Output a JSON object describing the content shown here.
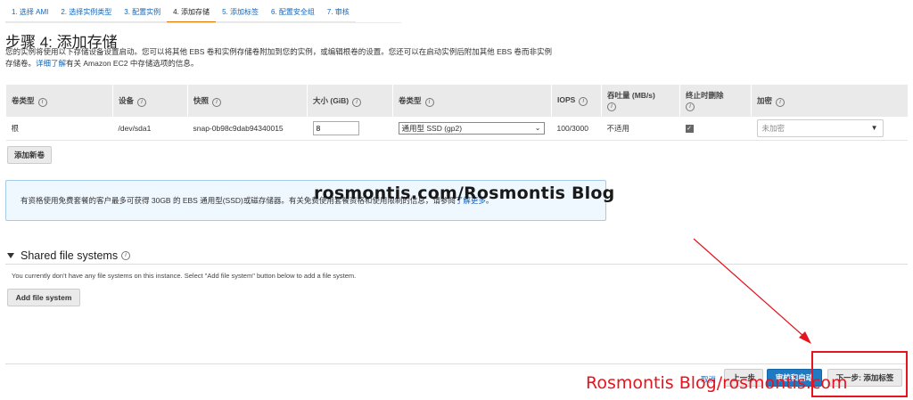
{
  "steps": [
    {
      "label": "1. 选择 AMI"
    },
    {
      "label": "2. 选择实例类型"
    },
    {
      "label": "3. 配置实例"
    },
    {
      "label": "4. 添加存储"
    },
    {
      "label": "5. 添加标签"
    },
    {
      "label": "6. 配置安全组"
    },
    {
      "label": "7. 审核"
    }
  ],
  "page_title": "步骤 4: 添加存储",
  "description": {
    "line1": "您的实例将使用以下存储设备设置启动。您可以将其他 EBS 卷和实例存储卷附加到您的实例，或编辑根卷的设置。您还可以在启动实例后附加其他 EBS 卷而非实例",
    "line2_prefix": "存储卷。",
    "link": "详细了解",
    "line2_suffix": "有关 Amazon EC2 中存储选项的信息。"
  },
  "table": {
    "headers": [
      "卷类型",
      "设备",
      "快照",
      "大小 (GiB)",
      "卷类型",
      "IOPS",
      "吞吐量 (MB/s)",
      "终止时删除",
      "加密"
    ],
    "row": {
      "volume_type": "根",
      "device": "/dev/sda1",
      "snapshot": "snap-0b98c9dab94340015",
      "size": "8",
      "ebs_type": "通用型 SSD (gp2)",
      "iops": "100/3000",
      "throughput": "不适用",
      "encryption": "未加密"
    }
  },
  "add_volume_button": "添加新卷",
  "notice": {
    "text": "有资格使用免费套餐的客户最多可获得 30GB 的 EBS 通用型(SSD)或磁存储器。有关免费使用套餐资格和使用限制的信息，请参阅",
    "link": "了解更多",
    "suffix": "。"
  },
  "watermark_top": "rosmontis.com/Rosmontis  Blog",
  "shared_fs": {
    "title": "Shared file systems",
    "message": "You currently don't have any file systems on this instance. Select \"Add file system\" button below to add a file system.",
    "add_button": "Add file system"
  },
  "footer": {
    "cancel": "取消",
    "previous": "上一步",
    "review_launch": "审核和启动",
    "next": "下一步: 添加标签"
  },
  "watermark_bottom": "Rosmontis  Blog/rosmontis.com",
  "colors": {
    "accent": "#1166bb",
    "primary_button": "#1f7ac4",
    "active_step": "#e77600",
    "annotation": "#e5141e"
  }
}
